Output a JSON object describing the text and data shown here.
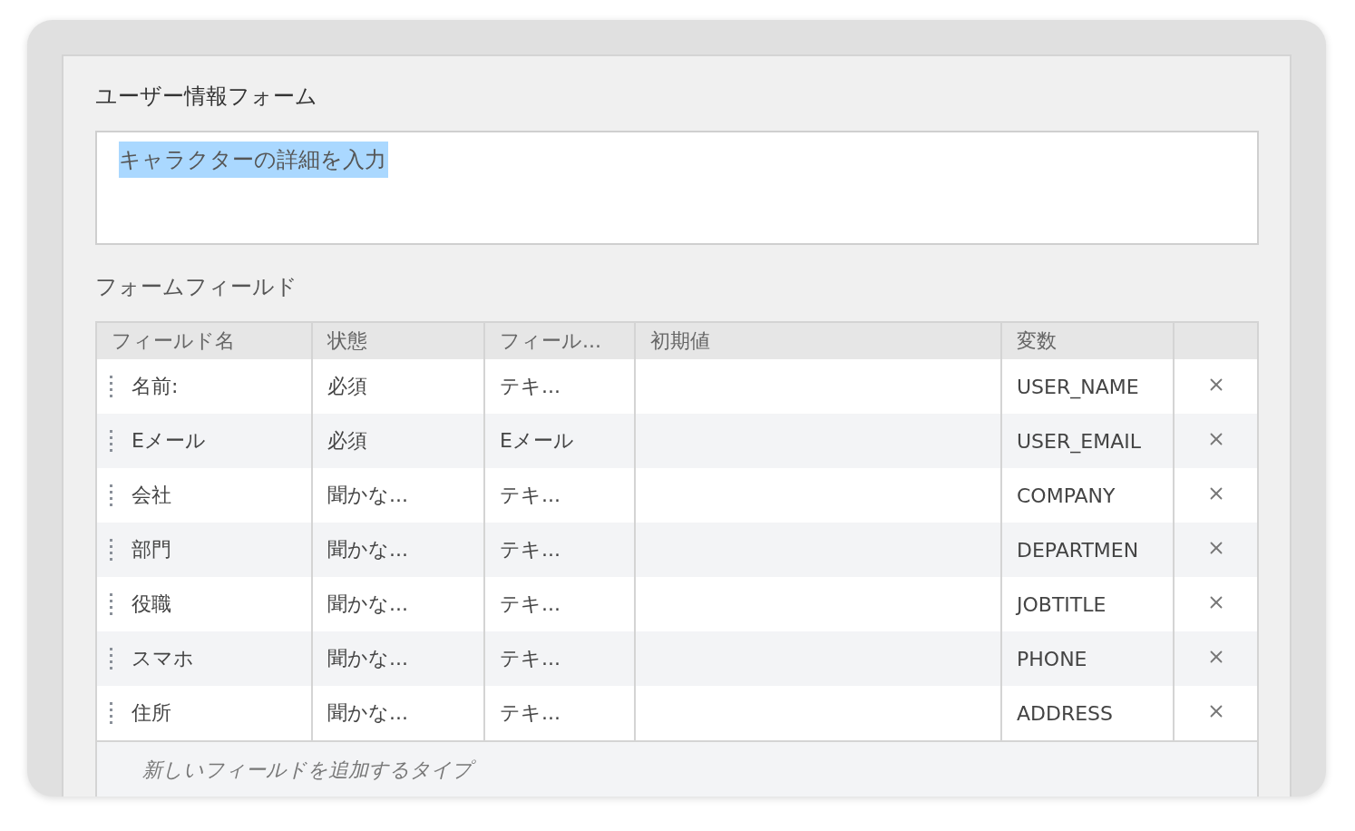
{
  "form_title": "ユーザー情報フォーム",
  "description": {
    "value": "キャラクターの詳細を入力",
    "selected": true
  },
  "section_title": "フォームフィールド",
  "table": {
    "columns": [
      "フィールド名",
      "状態",
      "フィール...",
      "初期値",
      "変数"
    ],
    "rows": [
      {
        "name": "名前:",
        "status": "必須",
        "type": "テキ...",
        "initial": "",
        "variable": "USER_NAME"
      },
      {
        "name": "Eメール",
        "status": "必須",
        "type": "Eメール",
        "initial": "",
        "variable": "USER_EMAIL"
      },
      {
        "name": "会社",
        "status": "聞かな...",
        "type": "テキ...",
        "initial": "",
        "variable": "COMPANY"
      },
      {
        "name": "部門",
        "status": "聞かな...",
        "type": "テキ...",
        "initial": "",
        "variable": "DEPARTMEN"
      },
      {
        "name": "役職",
        "status": "聞かな...",
        "type": "テキ...",
        "initial": "",
        "variable": "JOBTITLE"
      },
      {
        "name": "スマホ",
        "status": "聞かな...",
        "type": "テキ...",
        "initial": "",
        "variable": "PHONE"
      },
      {
        "name": "住所",
        "status": "聞かな...",
        "type": "テキ...",
        "initial": "",
        "variable": "ADDRESS"
      }
    ],
    "add_row": {
      "placeholder": "新しいフィールドを追加するタイプ"
    }
  }
}
